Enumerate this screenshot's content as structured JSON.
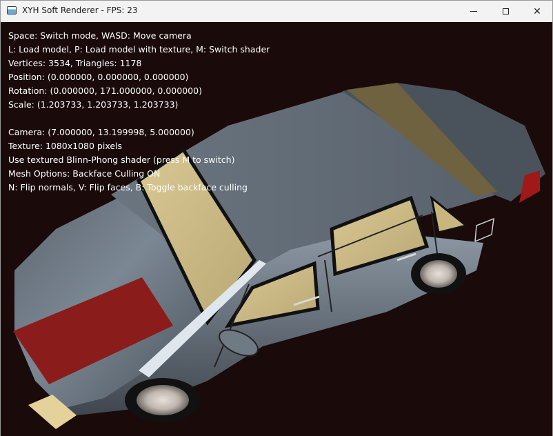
{
  "window": {
    "title": "XYH Soft Renderer - FPS: 23",
    "icon": "app-window-icon",
    "controls": {
      "minimize_icon": "minimize-icon",
      "maximize_icon": "maximize-icon",
      "close_icon": "close-icon",
      "close_glyph": "✕"
    }
  },
  "viewport": {
    "background": "#1a0a0a",
    "model": "car-model"
  },
  "overlay": {
    "line1": "Space: Switch mode, WASD: Move camera",
    "line2": "L: Load model, P: Load model with texture, M: Switch shader",
    "line3": "Vertices: 3534, Triangles: 1178",
    "line4": "Position: (0.000000, 0.000000, 0.000000)",
    "line5": "Rotation: (0.000000, 171.000000, 0.000000)",
    "line6": "Scale: (1.203733, 1.203733, 1.203733)",
    "line7": "Camera: (7.000000, 13.199998, 5.000000)",
    "line8": "Texture: 1080x1080 pixels",
    "line9": "Use textured Blinn-Phong shader (press M to switch)",
    "line10": "Mesh Options: Backface Culling ON",
    "line11": "N: Flip normals, V: Flip faces, B: Toggle backface culling"
  }
}
